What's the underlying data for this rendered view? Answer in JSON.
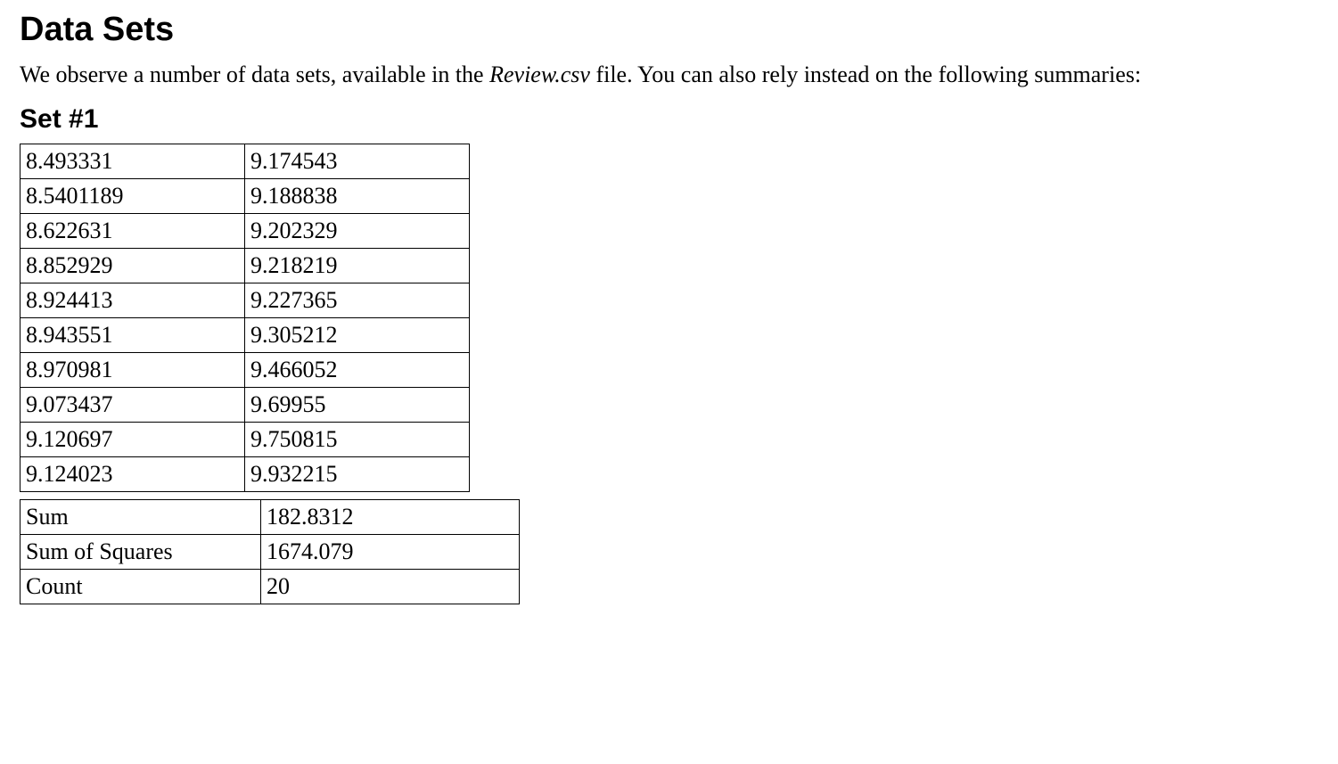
{
  "title": "Data Sets",
  "intro_pre": "We observe a number of data sets, available in the ",
  "intro_file": "Review.csv",
  "intro_post": " file. You can also rely instead on the following summaries:",
  "set1": {
    "heading": "Set #1",
    "rows": [
      {
        "a": "8.493331",
        "b": "9.174543"
      },
      {
        "a": "8.5401189",
        "b": "9.188838"
      },
      {
        "a": "8.622631",
        "b": "9.202329"
      },
      {
        "a": "8.852929",
        "b": "9.218219"
      },
      {
        "a": "8.924413",
        "b": "9.227365"
      },
      {
        "a": "8.943551",
        "b": "9.305212"
      },
      {
        "a": "8.970981",
        "b": "9.466052"
      },
      {
        "a": "9.073437",
        "b": "9.69955"
      },
      {
        "a": "9.120697",
        "b": "9.750815"
      },
      {
        "a": "9.124023",
        "b": "9.932215"
      }
    ],
    "summary": {
      "sum_label": "Sum",
      "sum_value": "182.8312",
      "ss_label": "Sum of Squares",
      "ss_value": "1674.079",
      "count_label": "Count",
      "count_value": "20"
    }
  }
}
